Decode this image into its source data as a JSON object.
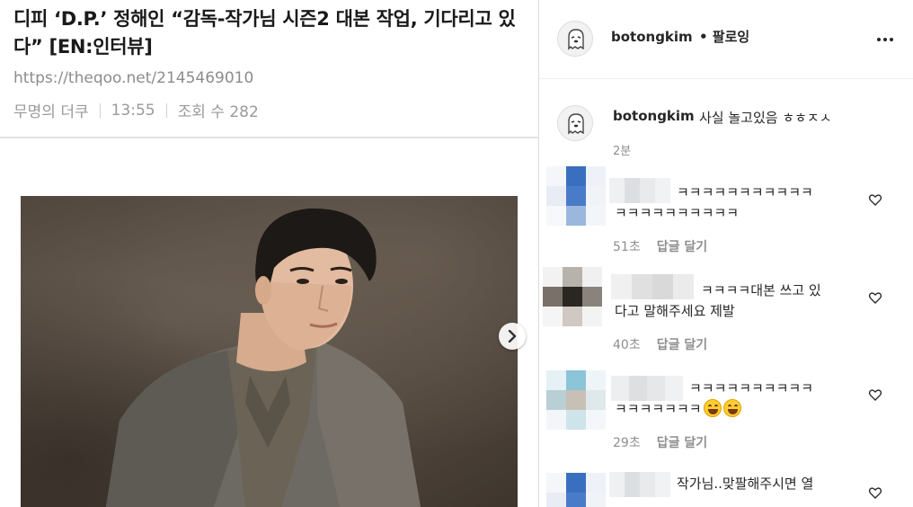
{
  "post": {
    "title": "디피 ‘D.P.’ 정해인 “감독-작가님 시즌2 대본 작업, 기다리고 있다” [EN:인터뷰]",
    "url": "https://theqoo.net/2145469010",
    "author": "무명의 더쿠",
    "time": "13:55",
    "views": "조회 수 282",
    "next_icon": "chevron-right-icon"
  },
  "instagram": {
    "header": {
      "username": "botongkim",
      "follow_label": "• 팔로잉",
      "more_icon": "more-horizontal-icon"
    },
    "caption": {
      "username": "botongkim",
      "text": "사실 놀고있음 ㅎㅎㅈㅅ",
      "time": "2분"
    },
    "comments": [
      {
        "text_line1": "ㅋㅋㅋㅋㅋㅋㅋㅋㅋㅋㅋ",
        "text_line2": "ㅋㅋㅋㅋㅋㅋㅋㅋㅋㅋ",
        "time": "51초",
        "reply_label": "답글 달기",
        "avatar_colors": [
          "#f4f6fa",
          "#3a6fc0",
          "#eef2f8",
          "#e8ecf4",
          "#4a7bc8",
          "#f0f3f8",
          "#f6f8fb",
          "#9cb7dd",
          "#f2f5f9"
        ],
        "name_colors": [
          "#eef0f2",
          "#dcdfe2",
          "#e8eaec",
          "#f1f2f4"
        ]
      },
      {
        "text_line1": "ㅋㅋㅋㅋ대본 쓰고 있",
        "text_line2": "다고 말해주세요 제발",
        "time": "40초",
        "reply_label": "답글 달기",
        "avatar_colors": [
          "#f2f2f2",
          "#b8b2ac",
          "#f0f0f0",
          "#7a706a",
          "#2a2622",
          "#8a827c",
          "#f5f5f5",
          "#d0c8c2",
          "#f3f3f3"
        ],
        "name_colors": [
          "#f0f0f0",
          "#e0e0e0",
          "#d9d9d9",
          "#ebebeb"
        ]
      },
      {
        "text_line1": "ㅋㅋㅋㅋㅋㅋㅋㅋㅋㅋ",
        "text_line2": "ㅋㅋㅋㅋㅋㅋㅋ",
        "emojis": [
          "grinning-face-emoji",
          "grinning-face-emoji"
        ],
        "time": "29초",
        "reply_label": "답글 달기",
        "avatar_colors": [
          "#e6f1f6",
          "#8cc4d8",
          "#eef5f8",
          "#b9cfd6",
          "#c8c0b4",
          "#dfe8ea",
          "#f2f6f8",
          "#cfe3ea",
          "#f4f7f9"
        ],
        "name_colors": [
          "#eceeef",
          "#dddfe0",
          "#e6e7e8",
          "#f0f1f2"
        ]
      },
      {
        "text_line1": "작가님..맞팔해주시면 열",
        "time": "",
        "reply_label": "",
        "avatar_colors": [
          "#f4f6fa",
          "#3a6fc0",
          "#eef2f8",
          "#e8ecf4",
          "#4a7bc8",
          "#f0f3f8",
          "#f6f8fb",
          "#9cb7dd",
          "#f2f5f9"
        ],
        "name_colors": [
          "#eef0f2",
          "#dcdfe2",
          "#e8eaec",
          "#f1f2f4"
        ]
      }
    ],
    "like_icon": "heart-outline-icon"
  }
}
